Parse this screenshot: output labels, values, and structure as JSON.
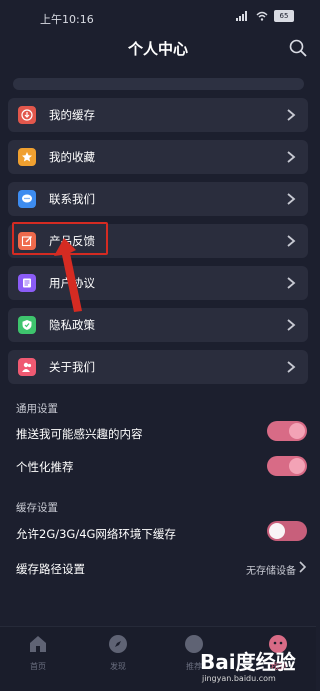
{
  "status_bar": {
    "time": "上午10:16",
    "battery": "65"
  },
  "header": {
    "title": "个人中心"
  },
  "menu": [
    {
      "label": "我的缓存",
      "icon": "download-icon",
      "color": "#e2574c"
    },
    {
      "label": "我的收藏",
      "icon": "star-icon",
      "color": "#f0a030"
    },
    {
      "label": "联系我们",
      "icon": "chat-icon",
      "color": "#3d8cf0"
    },
    {
      "label": "产品反馈",
      "icon": "edit-icon",
      "color": "#ef6a4c"
    },
    {
      "label": "用户协议",
      "icon": "document-icon",
      "color": "#8b5cf6"
    },
    {
      "label": "隐私政策",
      "icon": "shield-icon",
      "color": "#3ec46d"
    },
    {
      "label": "关于我们",
      "icon": "people-icon",
      "color": "#ef5a72"
    }
  ],
  "general_settings": {
    "title": "通用设置",
    "items": [
      {
        "label": "推送我可能感兴趣的内容",
        "enabled": true
      },
      {
        "label": "个性化推荐",
        "enabled": true
      }
    ]
  },
  "cache_settings": {
    "title": "缓存设置",
    "items": [
      {
        "label": "允许2G/3G/4G网络环境下缓存",
        "enabled": false
      }
    ],
    "storage_path_label": "缓存路径设置",
    "storage_path_value": "无存储设备"
  },
  "tabbar": [
    {
      "label": "首页",
      "icon": "home-icon"
    },
    {
      "label": "发现",
      "icon": "compass-icon"
    },
    {
      "label": "推荐",
      "icon": "circle-icon"
    },
    {
      "label": "我的",
      "icon": "profile-icon"
    }
  ],
  "watermark": {
    "text": "Bai度经验",
    "url": "jingyan.baidu.com"
  },
  "colors": {
    "background": "#1c1f2e",
    "card": "#2a2d3d",
    "accent": "#d86b86",
    "annotation": "#d52b22"
  }
}
